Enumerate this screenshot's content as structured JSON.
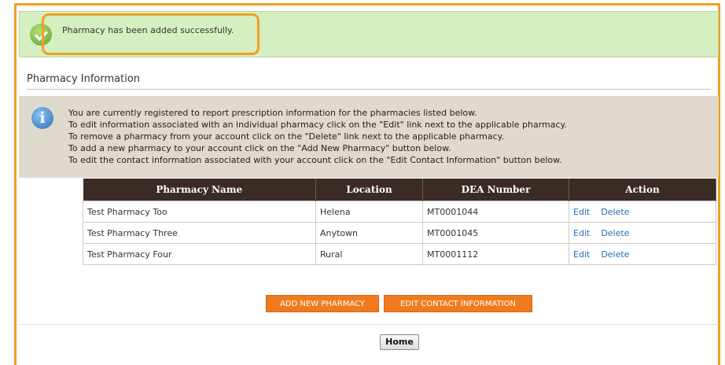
{
  "alert": {
    "message": "Pharmacy has been added successfully.",
    "icon": "checkmark-icon"
  },
  "section": {
    "title": "Pharmacy Information"
  },
  "info": {
    "icon": "info-icon",
    "icon_glyph": "i",
    "lines": [
      "You are currently registered to report prescription information for the pharmacies listed below.",
      "To edit information associated with an individual pharmacy click on the \"Edit\" link next to the applicable pharmacy.",
      "To remove a pharmacy from your account click on the \"Delete\" link next to the applicable pharmacy.",
      "To add a new pharmacy to your account click on the \"Add New Pharmacy\" button below.",
      "To edit the contact information associated with your account click on the \"Edit Contact Information\" button below."
    ]
  },
  "table": {
    "headers": [
      "Pharmacy Name",
      "Location",
      "DEA Number",
      "Action"
    ],
    "rows": [
      {
        "name": "Test Pharmacy Too",
        "location": "Helena",
        "dea": "MT0001044",
        "edit": "Edit",
        "delete": "Delete"
      },
      {
        "name": "Test Pharmacy Three",
        "location": "Anytown",
        "dea": "MT0001045",
        "edit": "Edit",
        "delete": "Delete"
      },
      {
        "name": "Test Pharmacy Four",
        "location": "Rural",
        "dea": "MT0001112",
        "edit": "Edit",
        "delete": "Delete"
      }
    ]
  },
  "buttons": {
    "add_new_pharmacy": "ADD NEW PHARMACY",
    "edit_contact_information": "EDIT CONTACT INFORMATION",
    "home": "Home"
  },
  "colors": {
    "success_bg": "#d6efc0",
    "highlight": "#f0a020",
    "info_bg": "#e0d9cd",
    "table_header_bg": "#3a2c24",
    "action_button": "#f07b1e",
    "link": "#2b6fb0"
  }
}
